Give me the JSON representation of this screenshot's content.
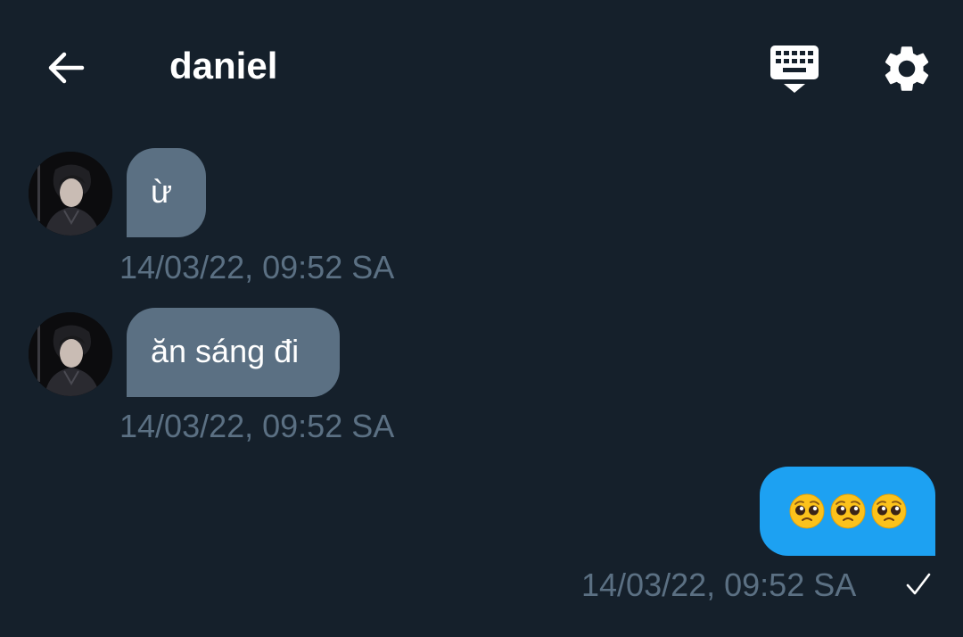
{
  "header": {
    "title": "daniel",
    "back_icon": "arrow-left-icon",
    "keyboard_icon": "keyboard-hide-icon",
    "settings_icon": "gear-icon"
  },
  "messages": [
    {
      "direction": "incoming",
      "text": "ừ",
      "timestamp": "14/03/22, 09:52 SA"
    },
    {
      "direction": "incoming",
      "text": "ăn sáng đi",
      "timestamp": "14/03/22, 09:52 SA"
    },
    {
      "direction": "outgoing",
      "emoji": [
        "pleading-face",
        "pleading-face",
        "pleading-face"
      ],
      "timestamp": "14/03/22, 09:52 SA",
      "status_icon": "checkmark-icon"
    }
  ],
  "colors": {
    "background": "#15202b",
    "incoming_bubble": "#5b7083",
    "outgoing_bubble": "#1da1f2",
    "timestamp": "#5b7083"
  }
}
